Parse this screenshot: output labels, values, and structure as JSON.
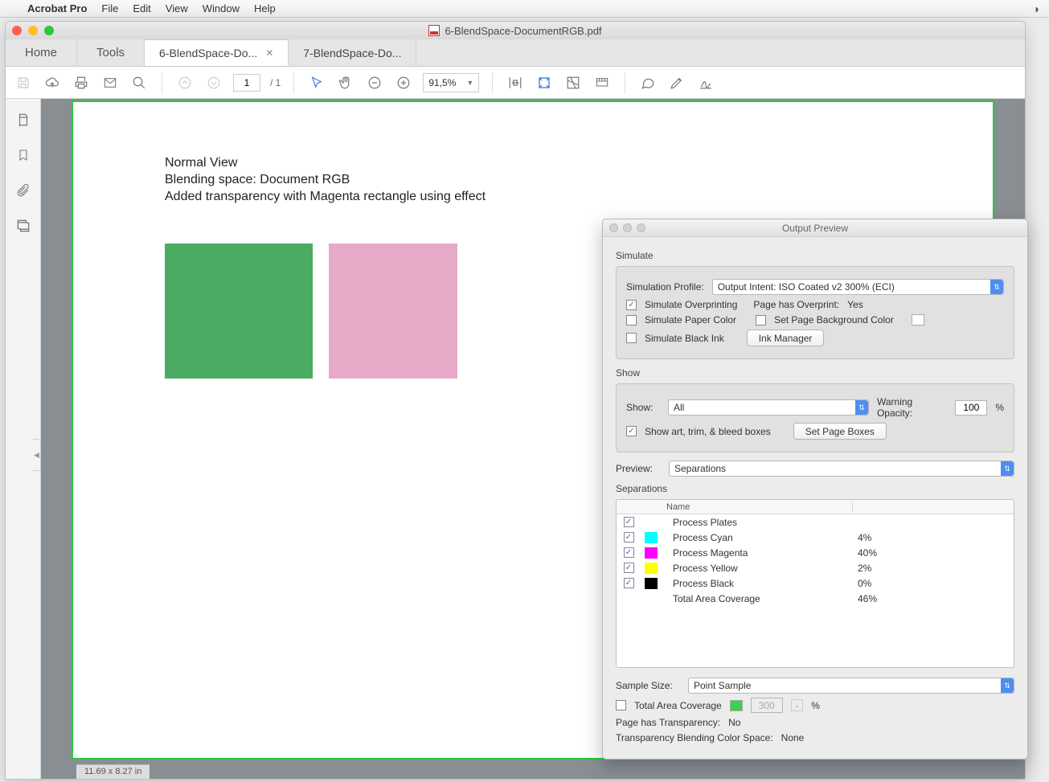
{
  "menubar": {
    "apple": "",
    "app": "Acrobat Pro",
    "items": [
      "File",
      "Edit",
      "View",
      "Window",
      "Help"
    ],
    "right": "⎋"
  },
  "window": {
    "title": "6-BlendSpace-DocumentRGB.pdf",
    "home": "Home",
    "tools": "Tools",
    "tabs": [
      {
        "label": "6-BlendSpace-Do...",
        "active": true
      },
      {
        "label": "7-BlendSpace-Do...",
        "active": false
      }
    ]
  },
  "toolbar": {
    "page_current": "1",
    "page_total": "/ 1",
    "zoom": "91,5%"
  },
  "document": {
    "line1": "Normal View",
    "line2": "Blending space: Document RGB",
    "line3": "Added transparency with Magenta rectangle using effect",
    "page_size": "11.69 x 8.27 in"
  },
  "panel": {
    "title": "Output Preview",
    "simulate": "Simulate",
    "sim_profile_label": "Simulation Profile:",
    "sim_profile_value": "Output Intent: ISO Coated v2 300% (ECI)",
    "sim_overprint": "Simulate Overprinting",
    "page_has_overprint_label": "Page has Overprint:",
    "page_has_overprint_value": "Yes",
    "sim_paper": "Simulate Paper Color",
    "set_bg": "Set Page Background Color",
    "sim_black": "Simulate Black Ink",
    "ink_manager": "Ink Manager",
    "show_h": "Show",
    "show_label": "Show:",
    "show_value": "All",
    "warning_opacity_label": "Warning Opacity:",
    "warning_opacity_value": "100",
    "percent": "%",
    "show_boxes": "Show art, trim, & bleed boxes",
    "set_page_boxes": "Set Page Boxes",
    "preview_label": "Preview:",
    "preview_value": "Separations",
    "separations_h": "Separations",
    "col_name": "Name",
    "rows": [
      {
        "chk": true,
        "color": "",
        "name": "Process Plates",
        "val": ""
      },
      {
        "chk": true,
        "color": "#00ffff",
        "name": "Process Cyan",
        "val": "4%"
      },
      {
        "chk": true,
        "color": "#ff00ff",
        "name": "Process Magenta",
        "val": "40%"
      },
      {
        "chk": true,
        "color": "#ffff00",
        "name": "Process Yellow",
        "val": "2%"
      },
      {
        "chk": true,
        "color": "#000000",
        "name": "Process Black",
        "val": "0%"
      },
      {
        "chk": false,
        "color": "",
        "name": "Total Area Coverage",
        "val": "46%",
        "nochk": true
      }
    ],
    "sample_size_label": "Sample Size:",
    "sample_size_value": "Point Sample",
    "tac_label": "Total Area Coverage",
    "tac_swatch": "#3bd24a",
    "tac_value": "300",
    "page_transp_label": "Page has Transparency:",
    "page_transp_value": "No",
    "blend_space_label": "Transparency Blending Color Space:",
    "blend_space_value": "None"
  }
}
